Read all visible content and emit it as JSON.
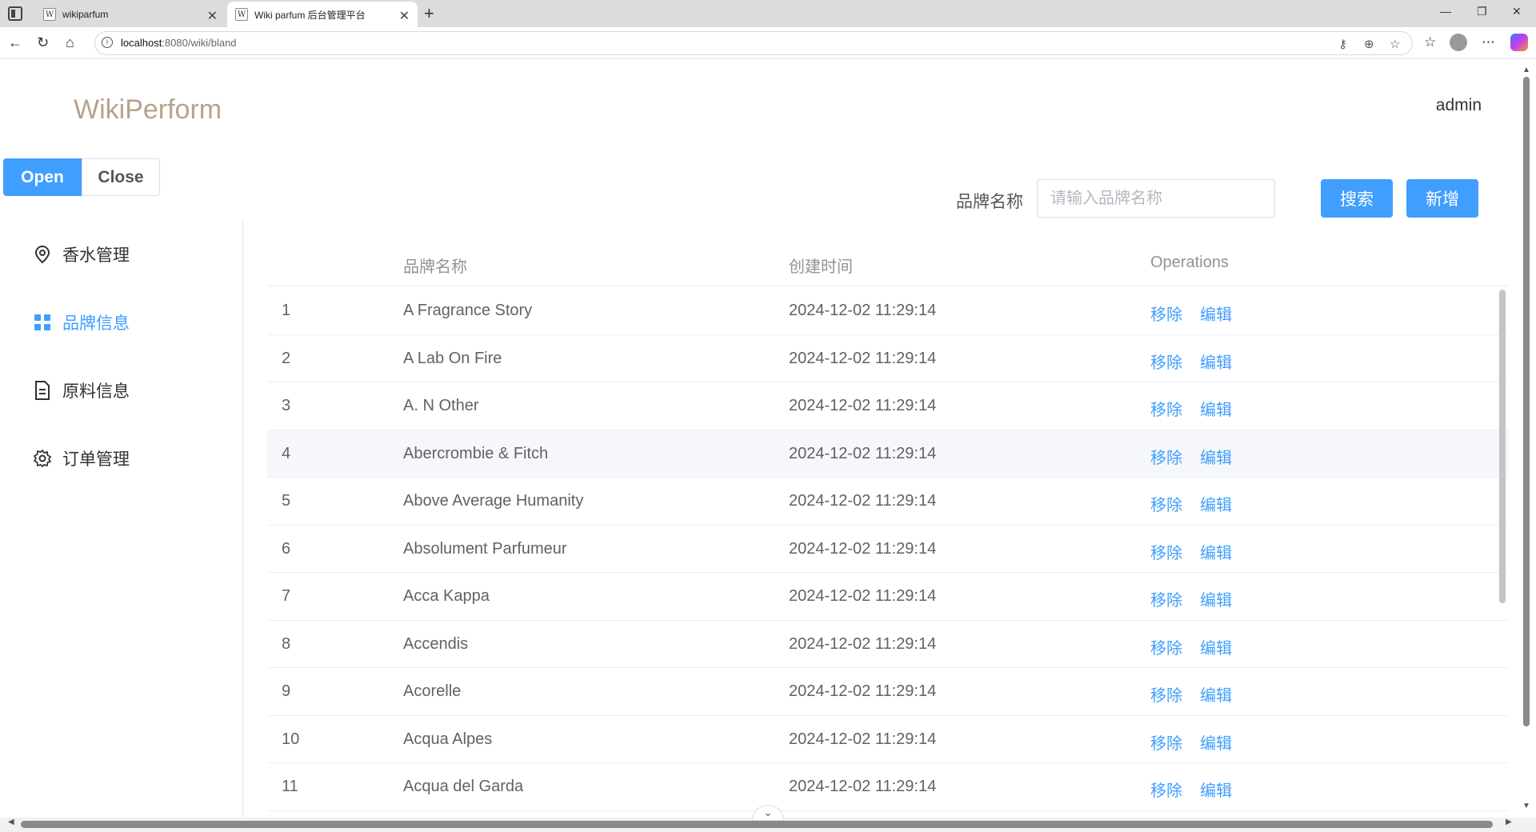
{
  "browser": {
    "tabs": [
      {
        "title": "wikiparfum",
        "favicon": "W"
      },
      {
        "title": "Wiki parfum 后台管理平台",
        "favicon": "W"
      }
    ],
    "url_host": "localhost",
    "url_rest": ":8080/wiki/bland"
  },
  "header": {
    "brand": "WikiPerform",
    "user": "admin"
  },
  "toggle": {
    "open_label": "Open",
    "close_label": "Close"
  },
  "sidebar": {
    "items": [
      {
        "label": "香水管理",
        "icon": "location-pin-icon"
      },
      {
        "label": "品牌信息",
        "icon": "grid-icon",
        "active": true
      },
      {
        "label": "原料信息",
        "icon": "document-icon"
      },
      {
        "label": "订单管理",
        "icon": "gear-icon"
      }
    ]
  },
  "search": {
    "label": "品牌名称",
    "placeholder": "请输入品牌名称",
    "search_button": "搜索",
    "add_button": "新增"
  },
  "table": {
    "columns": [
      "品牌名称",
      "创建时间",
      "Operations"
    ],
    "op_remove": "移除",
    "op_edit": "编辑",
    "rows": [
      {
        "id": "1",
        "name": "A Fragrance Story",
        "created": "2024-12-02 11:29:14"
      },
      {
        "id": "2",
        "name": "A Lab On Fire",
        "created": "2024-12-02 11:29:14"
      },
      {
        "id": "3",
        "name": "A. N Other",
        "created": "2024-12-02 11:29:14"
      },
      {
        "id": "4",
        "name": "Abercrombie & Fitch",
        "created": "2024-12-02 11:29:14"
      },
      {
        "id": "5",
        "name": "Above Average Humanity",
        "created": "2024-12-02 11:29:14"
      },
      {
        "id": "6",
        "name": "Absolument Parfumeur",
        "created": "2024-12-02 11:29:14"
      },
      {
        "id": "7",
        "name": "Acca Kappa",
        "created": "2024-12-02 11:29:14"
      },
      {
        "id": "8",
        "name": "Accendis",
        "created": "2024-12-02 11:29:14"
      },
      {
        "id": "9",
        "name": "Acorelle",
        "created": "2024-12-02 11:29:14"
      },
      {
        "id": "10",
        "name": "Acqua Alpes",
        "created": "2024-12-02 11:29:14"
      },
      {
        "id": "11",
        "name": "Acqua del Garda",
        "created": "2024-12-02 11:29:14"
      }
    ]
  },
  "colors": {
    "primary": "#409eff",
    "brand_text": "#b6a38a"
  }
}
